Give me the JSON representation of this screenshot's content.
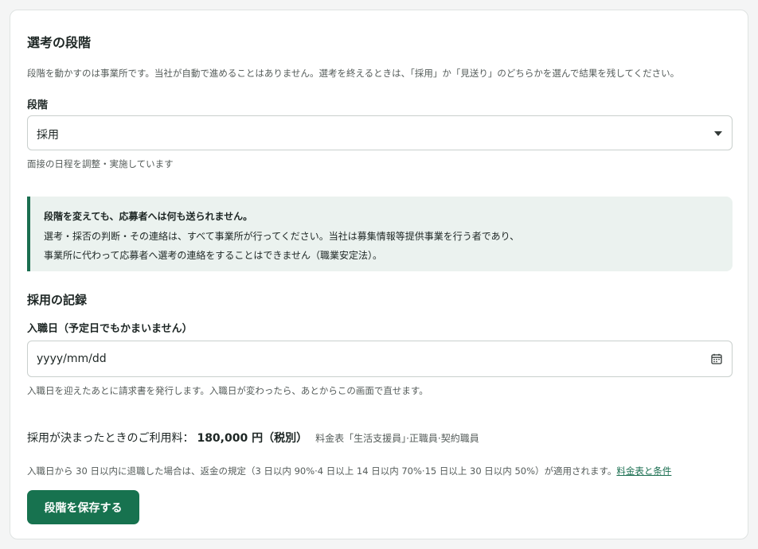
{
  "stage_section": {
    "title": "選考の段階",
    "description": "段階を動かすのは事業所です。当社が自動で進めることはありません。選考を終えるときは、「採用」か「見送り」のどちらかを選んで結果を残してください。",
    "stage_label": "段階",
    "stage_select": {
      "value": "採用",
      "icon": "chevron-down-icon"
    },
    "stage_hint": "面接の日程を調整・実施しています"
  },
  "notice": {
    "title": "段階を変えても、応募者へは何も送られません。",
    "line1": "選考・採否の判断・その連絡は、すべて事業所が行ってください。当社は募集情報等提供事業を行う者であり、",
    "line2": "事業所に代わって応募者へ選考の連絡をすることはできません（職業安定法）。",
    "accent_color": "#1a6e50"
  },
  "hire_record": {
    "title": "採用の記録",
    "join_date_label": "入職日（予定日でもかまいません）",
    "join_date_placeholder": "yyyy/mm/dd",
    "join_date_icon": "calendar-icon",
    "join_date_hint": "入職日を迎えたあとに請求書を発行します。入職日が変わったら、あとからこの画面で直せます。"
  },
  "fee": {
    "label": "採用が決まったときのご利用料：",
    "amount": "180,000 円（税別）",
    "note": "料金表「生活支援員」·正職員·契約職員"
  },
  "refund": {
    "text": "入職日から 30 日以内に退職した場合は、返金の規定（3 日以内 90%·4 日以上 14 日以内 70%·15 日以上 30 日以内 50%）が適用されます。",
    "link_label": "料金表と条件"
  },
  "actions": {
    "save_label": "段階を保存する",
    "button_color": "#17724f"
  }
}
